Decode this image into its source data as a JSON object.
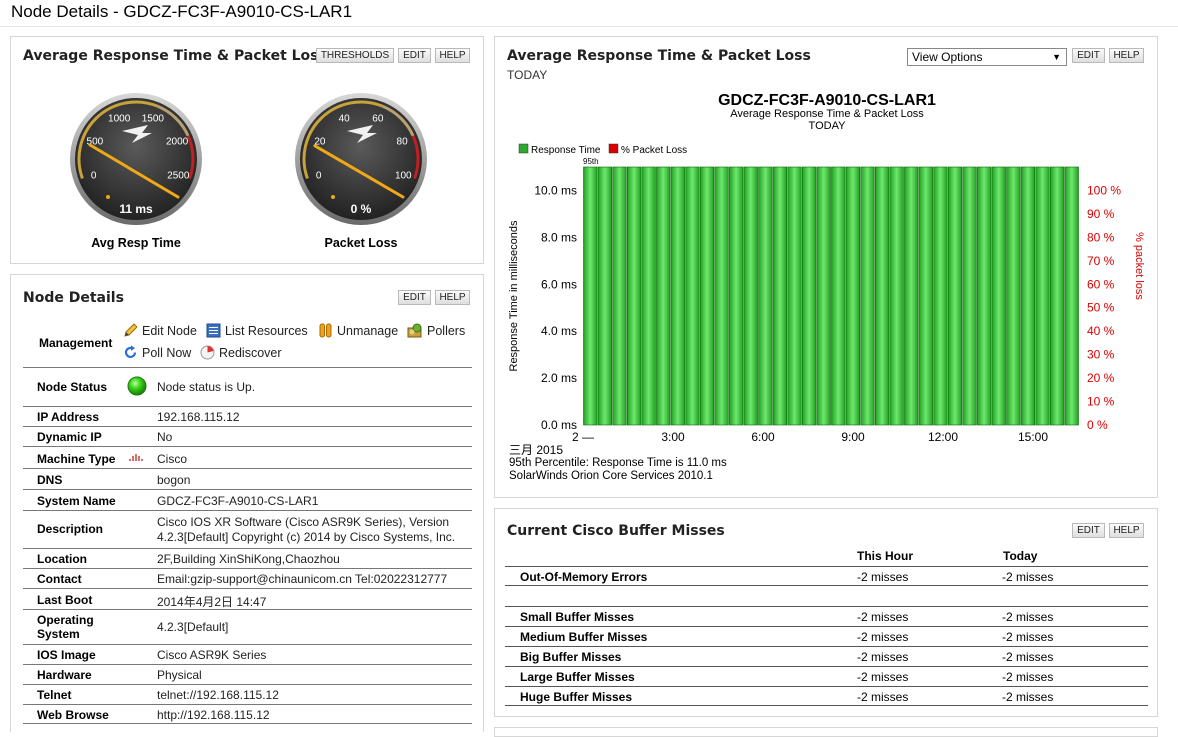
{
  "page": {
    "title": "Node Details - GDCZ-FC3F-A9010-CS-LAR1"
  },
  "gauges_panel": {
    "title": "Average Response Time & Packet Loss",
    "buttons": {
      "thresholds": "THRESHOLDS",
      "edit": "EDIT",
      "help": "HELP"
    },
    "gauges": [
      {
        "label": "Avg Resp Time",
        "value_text": "11 ms",
        "value": 11,
        "max": 2500,
        "ticks": [
          "0",
          "500",
          "1000",
          "1500",
          "2000",
          "2500"
        ]
      },
      {
        "label": "Packet Loss",
        "value_text": "0 %",
        "value": 0,
        "max": 100,
        "ticks": [
          "0",
          "20",
          "40",
          "60",
          "80",
          "100"
        ]
      }
    ]
  },
  "details_panel": {
    "title": "Node Details",
    "buttons": {
      "edit": "EDIT",
      "help": "HELP"
    },
    "management": {
      "label": "Management",
      "links": {
        "edit_node": "Edit Node",
        "list_resources": "List Resources",
        "unmanage": "Unmanage",
        "pollers": "Pollers",
        "poll_now": "Poll Now",
        "rediscover": "Rediscover"
      }
    },
    "node_status": {
      "label": "Node Status",
      "value": "Node status is Up."
    },
    "rows": {
      "ip": {
        "label": "IP Address",
        "value": "192.168.115.12"
      },
      "dynamic_ip": {
        "label": "Dynamic IP",
        "value": "No"
      },
      "machine_type": {
        "label": "Machine Type",
        "value": "Cisco"
      },
      "dns": {
        "label": "DNS",
        "value": "bogon"
      },
      "system_name": {
        "label": "System Name",
        "value": "GDCZ-FC3F-A9010-CS-LAR1"
      },
      "description": {
        "label": "Description",
        "value_line1": "Cisco IOS XR Software (Cisco ASR9K Series), Version",
        "value_line2": "4.2.3[Default] Copyright (c) 2014 by Cisco Systems, Inc."
      },
      "location": {
        "label": "Location",
        "value": "2F,Building XinShiKong,Chaozhou"
      },
      "contact": {
        "label": "Contact",
        "value": "Email:gzip-support@chinaunicom.cn Tel:02022312777"
      },
      "last_boot": {
        "label": "Last Boot",
        "value": "2014年4月2日 14:47"
      },
      "os": {
        "label_line1": "Operating",
        "label_line2": "System",
        "value": "4.2.3[Default]"
      },
      "ios_image": {
        "label": "IOS Image",
        "value": "Cisco ASR9K Series"
      },
      "hardware": {
        "label": "Hardware",
        "value": "Physical"
      },
      "telnet": {
        "label": "Telnet",
        "value": "telnet://192.168.115.12"
      },
      "web_browse": {
        "label": "Web Browse",
        "value": "http://192.168.115.12"
      }
    }
  },
  "chart_panel": {
    "title": "Average Response Time & Packet Loss",
    "subtitle": "TODAY",
    "view_options": "View Options",
    "buttons": {
      "edit": "EDIT",
      "help": "HELP"
    },
    "footer": {
      "date": "三月 2015",
      "percentile": "95th Percentile: Response Time is 11.0  ms",
      "product": "SolarWinds Orion Core Services 2010.1"
    }
  },
  "chart_data": {
    "type": "bar",
    "title": "GDCZ-FC3F-A9010-CS-LAR1",
    "subtitle": "Average Response Time & Packet Loss",
    "subtitle2": "TODAY",
    "ylabel": "Response Time in milliseconds",
    "y2label": "% packet loss",
    "ylim": [
      0,
      11
    ],
    "y2lim": [
      0,
      110
    ],
    "yticks": [
      "0.0 ms",
      "2.0 ms",
      "4.0 ms",
      "6.0 ms",
      "8.0 ms",
      "10.0 ms"
    ],
    "y2ticks": [
      "0 %",
      "10 %",
      "20 %",
      "30 %",
      "40 %",
      "50 %",
      "60 %",
      "70 %",
      "80 %",
      "90 %",
      "100 %"
    ],
    "xticks": [
      "2 —",
      "3:00",
      "6:00",
      "9:00",
      "12:00",
      "15:00"
    ],
    "percentile_label": "95th",
    "percentile_value": 11.0,
    "legend": [
      {
        "name": "Response Time",
        "color": "#2ea82e"
      },
      {
        "name": "% Packet Loss",
        "color": "#dd0000"
      }
    ],
    "series": [
      {
        "name": "Response Time",
        "color": "#2ea82e",
        "values": [
          11,
          11,
          11,
          11,
          11,
          11,
          11,
          11,
          11,
          11,
          11,
          11,
          11,
          11,
          11,
          11,
          11,
          11,
          11,
          11,
          11,
          11,
          11,
          11,
          11,
          11,
          11,
          11,
          11,
          11,
          11,
          11,
          11,
          11
        ]
      },
      {
        "name": "% Packet Loss",
        "color": "#dd0000",
        "values": [
          0,
          0,
          0,
          0,
          0,
          0,
          0,
          0,
          0,
          0,
          0,
          0,
          0,
          0,
          0,
          0,
          0,
          0,
          0,
          0,
          0,
          0,
          0,
          0,
          0,
          0,
          0,
          0,
          0,
          0,
          0,
          0,
          0,
          0
        ]
      }
    ]
  },
  "buffer_panel": {
    "title": "Current Cisco Buffer Misses",
    "buttons": {
      "edit": "EDIT",
      "help": "HELP"
    },
    "columns": [
      "",
      "This Hour",
      "Today"
    ],
    "rows": [
      {
        "label": "Out-Of-Memory Errors",
        "hour": "-2 misses",
        "today": "-2 misses"
      },
      {
        "label": "Small Buffer Misses",
        "hour": "-2 misses",
        "today": "-2 misses"
      },
      {
        "label": "Medium Buffer Misses",
        "hour": "-2 misses",
        "today": "-2 misses"
      },
      {
        "label": "Big Buffer Misses",
        "hour": "-2 misses",
        "today": "-2 misses"
      },
      {
        "label": "Large Buffer Misses",
        "hour": "-2 misses",
        "today": "-2 misses"
      },
      {
        "label": "Huge Buffer Misses",
        "hour": "-2 misses",
        "today": "-2 misses"
      }
    ]
  }
}
